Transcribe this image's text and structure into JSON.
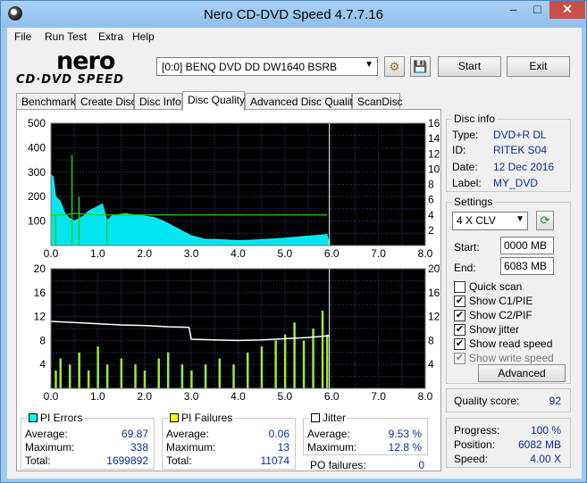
{
  "window": {
    "title": "Nero CD-DVD Speed 4.7.7.16",
    "minimize": "–",
    "maximize": "□",
    "close": "✕"
  },
  "menu": [
    "File",
    "Run Test",
    "Extra",
    "Help"
  ],
  "logo": {
    "top": "nero",
    "bottom": "CD·DVD SPEED"
  },
  "toolbar": {
    "drive": "[0:0]   BENQ DVD DD DW1640 BSRB",
    "start": "Start",
    "exit": "Exit"
  },
  "tabs": [
    "Benchmark",
    "Create Disc",
    "Disc Info",
    "Disc Quality",
    "Advanced Disc Quality",
    "ScanDisc"
  ],
  "active_tab": "Disc Quality",
  "disc_info": {
    "title": "Disc info",
    "type_label": "Type:",
    "type": "DVD+R DL",
    "id_label": "ID:",
    "id": "RITEK S04",
    "date_label": "Date:",
    "date": "12 Dec 2016",
    "label_label": "Label:",
    "label": "MY_DVD"
  },
  "settings": {
    "title": "Settings",
    "speed": "4 X CLV",
    "start_label": "Start:",
    "start": "0000 MB",
    "end_label": "End:",
    "end": "6083 MB",
    "quick_scan": "Quick scan",
    "show_c1": "Show C1/PIE",
    "show_c2": "Show C2/PIF",
    "show_jitter": "Show jitter",
    "show_read": "Show read speed",
    "show_write": "Show write speed",
    "advanced": "Advanced"
  },
  "quality": {
    "label": "Quality score:",
    "value": "92"
  },
  "progress": {
    "progress_label": "Progress:",
    "progress": "100 %",
    "position_label": "Position:",
    "position": "6082 MB",
    "speed_label": "Speed:",
    "speed": "4.00 X"
  },
  "pi_errors": {
    "title": "PI Errors",
    "color": "#00ffff",
    "average_label": "Average:",
    "average": "69.87",
    "maximum_label": "Maximum:",
    "maximum": "338",
    "total_label": "Total:",
    "total": "1699892"
  },
  "pi_failures": {
    "title": "PI Failures",
    "color": "#ffff00",
    "average_label": "Average:",
    "average": "0.06",
    "maximum_label": "Maximum:",
    "maximum": "13",
    "total_label": "Total:",
    "total": "11074"
  },
  "jitter": {
    "title": "Jitter",
    "color": "#ffffff",
    "average_label": "Average:",
    "average": "9.53 %",
    "maximum_label": "Maximum:",
    "maximum": "12.8 %",
    "po_label": "PO failures:",
    "po": "0"
  },
  "chart_data": [
    {
      "type": "area",
      "x_ticks": [
        "0.0",
        "1.0",
        "2.0",
        "3.0",
        "4.0",
        "5.0",
        "6.0",
        "7.0",
        "8.0"
      ],
      "y_left_ticks": [
        "500",
        "400",
        "300",
        "200",
        "100"
      ],
      "y_right_ticks": [
        "16",
        "14",
        "12",
        "10",
        "8",
        "6",
        "4",
        "2"
      ],
      "xlim": [
        0,
        8
      ],
      "ylim_left": [
        0,
        500
      ],
      "ylim_right": [
        0,
        16
      ],
      "series": [
        {
          "values": [
            [
              0,
              290
            ],
            [
              0.05,
              280
            ],
            [
              0.1,
              200
            ],
            [
              0.2,
              180
            ],
            [
              0.3,
              130
            ],
            [
              0.4,
              110
            ],
            [
              0.5,
              100
            ],
            [
              0.6,
              110
            ],
            [
              0.7,
              120
            ],
            [
              0.8,
              140
            ],
            [
              0.9,
              150
            ],
            [
              1.0,
              160
            ],
            [
              1.1,
              170
            ],
            [
              1.2,
              100
            ],
            [
              1.3,
              120
            ],
            [
              1.4,
              125
            ],
            [
              1.5,
              128
            ],
            [
              1.6,
              130
            ],
            [
              1.8,
              125
            ],
            [
              2.0,
              120
            ],
            [
              2.2,
              115
            ],
            [
              2.4,
              100
            ],
            [
              2.5,
              90
            ],
            [
              2.6,
              80
            ],
            [
              2.7,
              70
            ],
            [
              2.8,
              60
            ],
            [
              2.9,
              50
            ],
            [
              3.0,
              40
            ],
            [
              3.1,
              35
            ],
            [
              3.2,
              30
            ],
            [
              3.3,
              25
            ],
            [
              3.5,
              25
            ],
            [
              3.8,
              22
            ],
            [
              4.0,
              20
            ],
            [
              4.3,
              22
            ],
            [
              4.6,
              25
            ],
            [
              5.0,
              30
            ],
            [
              5.3,
              35
            ],
            [
              5.6,
              40
            ],
            [
              5.9,
              45
            ],
            [
              5.95,
              0
            ]
          ]
        },
        {
          "values": [
            [
              0,
              4
            ],
            [
              0.3,
              4
            ],
            [
              0.5,
              4.2
            ],
            [
              1.0,
              4
            ],
            [
              2.0,
              4
            ],
            [
              3.0,
              4
            ],
            [
              4.0,
              4
            ],
            [
              5.0,
              4
            ],
            [
              5.9,
              4
            ]
          ]
        }
      ]
    },
    {
      "type": "bar",
      "x_ticks": [
        "0.0",
        "1.0",
        "2.0",
        "3.0",
        "4.0",
        "5.0",
        "6.0",
        "7.0",
        "8.0"
      ],
      "y_left_ticks": [
        "20",
        "16",
        "12",
        "8",
        "4"
      ],
      "y_right_ticks": [
        "20",
        "16",
        "12",
        "8",
        "4"
      ],
      "xlim": [
        0,
        8
      ],
      "ylim": [
        0,
        20
      ],
      "series": [
        {
          "values": [
            [
              0,
              11.2
            ],
            [
              0.5,
              11.0
            ],
            [
              1.0,
              10.8
            ],
            [
              1.5,
              10.6
            ],
            [
              2.0,
              10.5
            ],
            [
              2.5,
              10.3
            ],
            [
              2.95,
              10.2
            ],
            [
              3.0,
              8.2
            ],
            [
              3.5,
              8.1
            ],
            [
              4.0,
              8.0
            ],
            [
              4.5,
              8.1
            ],
            [
              5.0,
              8.3
            ],
            [
              5.5,
              8.5
            ],
            [
              5.95,
              8.8
            ]
          ]
        },
        {
          "values": [
            [
              0.1,
              3
            ],
            [
              0.2,
              5
            ],
            [
              0.4,
              4
            ],
            [
              0.6,
              6
            ],
            [
              0.8,
              3
            ],
            [
              1.0,
              7
            ],
            [
              1.2,
              4
            ],
            [
              1.5,
              5
            ],
            [
              1.8,
              4
            ],
            [
              2.0,
              3
            ],
            [
              2.3,
              5
            ],
            [
              2.5,
              6
            ],
            [
              2.8,
              4
            ],
            [
              3.0,
              3
            ],
            [
              3.3,
              4
            ],
            [
              3.6,
              5
            ],
            [
              3.9,
              4
            ],
            [
              4.2,
              6
            ],
            [
              4.5,
              7
            ],
            [
              4.8,
              8
            ],
            [
              5.0,
              9
            ],
            [
              5.2,
              11
            ],
            [
              5.4,
              8
            ],
            [
              5.6,
              10
            ],
            [
              5.8,
              13
            ],
            [
              5.9,
              9
            ]
          ]
        }
      ]
    }
  ]
}
